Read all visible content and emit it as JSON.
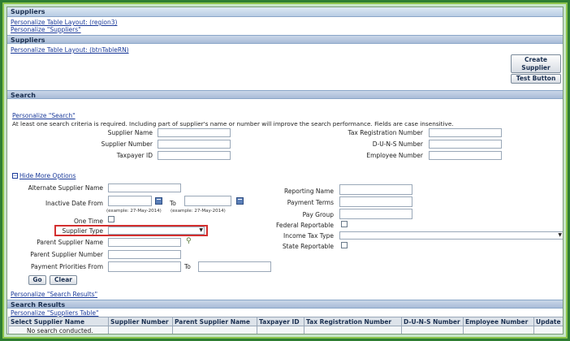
{
  "page": {
    "title": "Suppliers",
    "personalize_region3": "Personalize Table Layout: (region3)",
    "personalize_suppliers": "Personalize \"Suppliers\""
  },
  "suppliers_section": {
    "title": "Suppliers",
    "personalize_btn_table": "Personalize Table Layout: (btnTableRN)",
    "create_supplier": "Create Supplier",
    "test_button": "Test Button"
  },
  "search": {
    "title": "Search",
    "personalize_search": "Personalize \"Search\"",
    "instructions": "At least one search criteria is required. Including part of supplier's name or number will improve the search performance. Fields are case insensitive.",
    "supplier_name": "Supplier Name",
    "supplier_number": "Supplier Number",
    "taxpayer_id": "Taxpayer ID",
    "tax_registration_number": "Tax Registration Number",
    "duns_number": "D-U-N-S Number",
    "employee_number": "Employee Number",
    "hide_more_options": "Hide More Options",
    "alternate_supplier_name": "Alternate Supplier Name",
    "inactive_date_from": "Inactive Date From",
    "to": "To",
    "date_example_from": "(example: 27-May-2014)",
    "date_example_to": "(example: 27-May-2014)",
    "one_time": "One Time",
    "supplier_type": "Supplier Type",
    "parent_supplier_name": "Parent Supplier Name",
    "parent_supplier_number": "Parent Supplier Number",
    "payment_priorities_from": "Payment Priorities From",
    "to2": "To",
    "reporting_name": "Reporting Name",
    "payment_terms": "Payment Terms",
    "pay_group": "Pay Group",
    "federal_reportable": "Federal Reportable",
    "income_tax_type": "Income Tax Type",
    "state_reportable": "State Reportable",
    "go": "Go",
    "clear": "Clear",
    "personalize_search_results": "Personalize \"Search Results\""
  },
  "results": {
    "title": "Search Results",
    "personalize_table": "Personalize \"Suppliers Table\"",
    "columns": [
      "Select Supplier Name",
      "Supplier Number",
      "Parent Supplier Name",
      "Taxpayer ID",
      "Tax Registration Number",
      "D-U-N-S Number",
      "Employee Number",
      "Update"
    ],
    "empty_message": "No search conducted."
  },
  "colors": {
    "outer_frame": "#2e7d32",
    "highlight": "#d32f2f",
    "link": "#1a3a9a"
  }
}
